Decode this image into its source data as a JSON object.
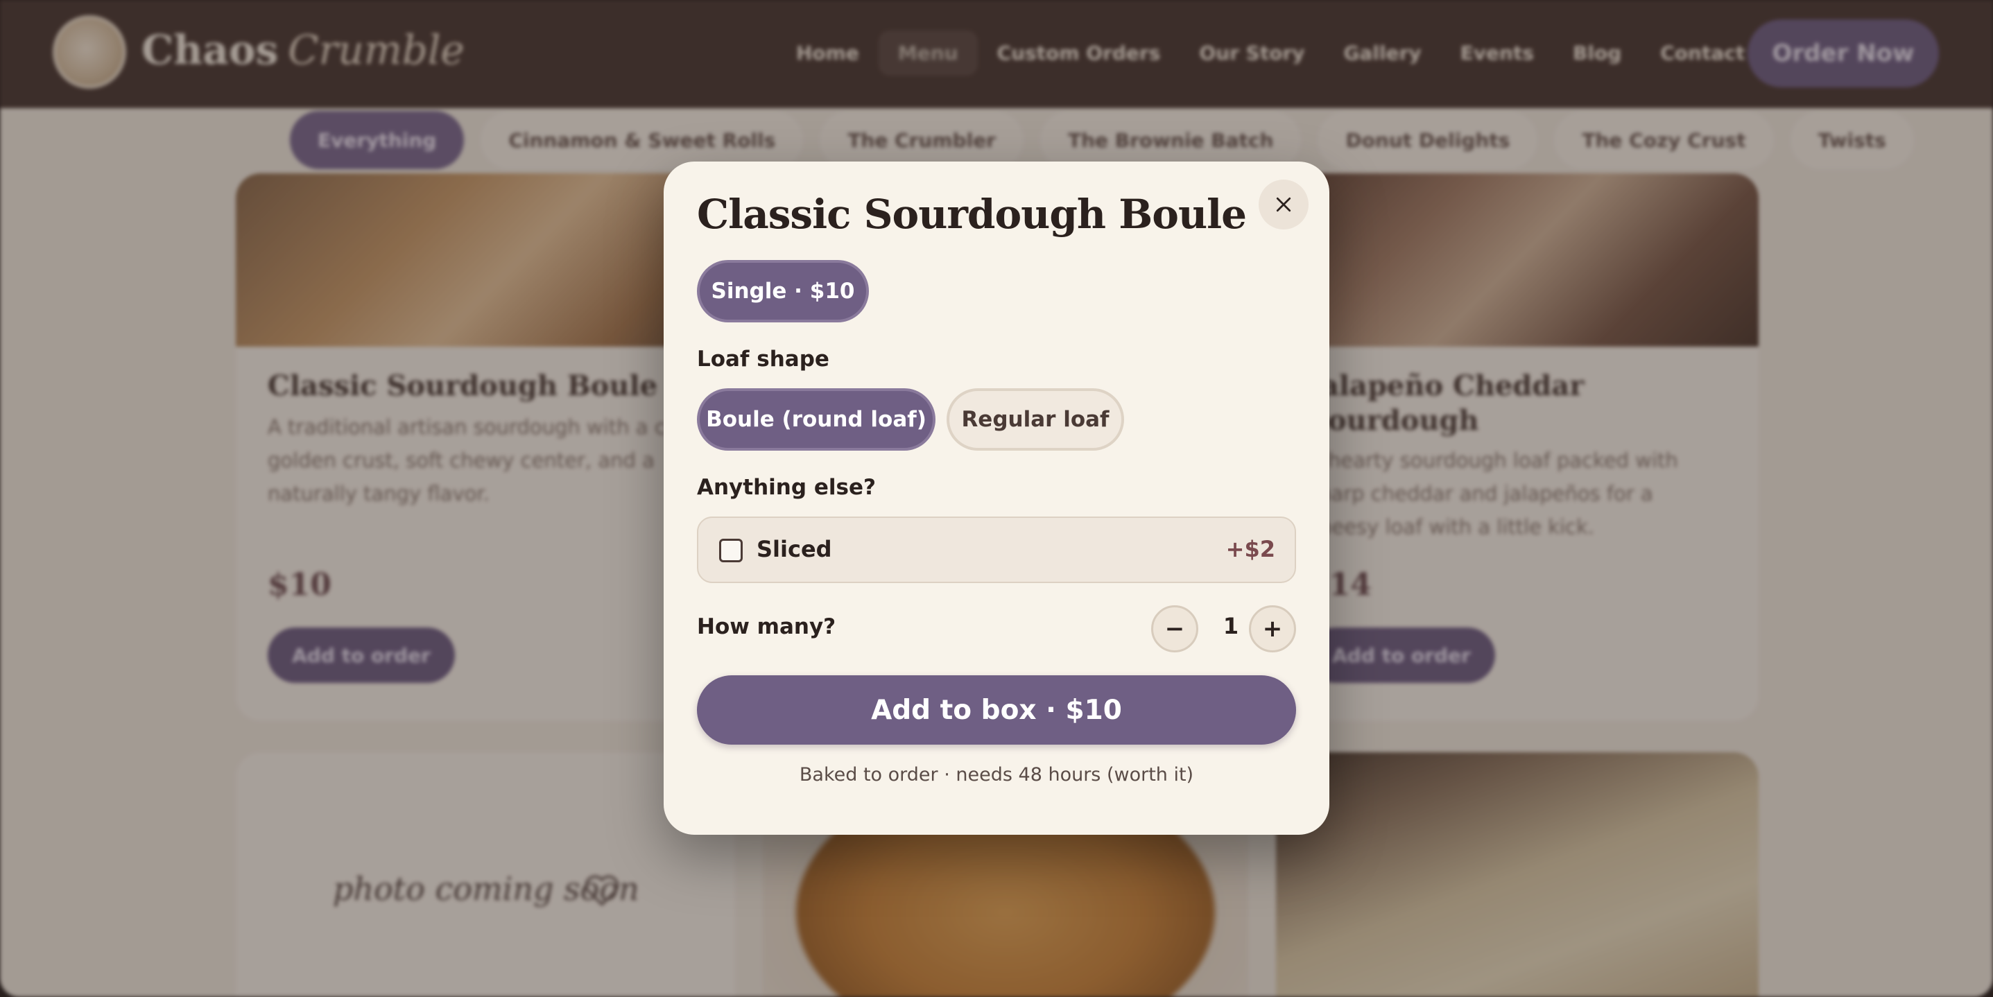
{
  "brand": {
    "name": "Chaos",
    "name_accent": "Crumble"
  },
  "nav": {
    "items": [
      {
        "label": "Home",
        "active": false
      },
      {
        "label": "Menu",
        "active": true
      },
      {
        "label": "Custom Orders",
        "active": false
      },
      {
        "label": "Our Story",
        "active": false
      },
      {
        "label": "Gallery",
        "active": false
      },
      {
        "label": "Events",
        "active": false
      },
      {
        "label": "Blog",
        "active": false
      },
      {
        "label": "Contact",
        "active": false
      }
    ],
    "cta": "Order Now"
  },
  "categories": [
    "Everything",
    "Cinnamon & Sweet Rolls",
    "The Crumbler",
    "The Brownie Batch",
    "Donut Delights",
    "The Cozy Crust",
    "Twists"
  ],
  "background_cards": [
    {
      "title": "Classic Sourdough Boule",
      "description": "A traditional artisan sourdough with a crisp golden crust, soft chewy center, and a naturally tangy flavor.",
      "price": "$10",
      "button": "Add to order"
    },
    {
      "title": "Jalapeño Cheddar Sourdough",
      "description": "A hearty sourdough loaf packed with sharp cheddar and jalapeños for a cheesy loaf with a little kick.",
      "price": "$14",
      "button": "Add to order"
    }
  ],
  "placeholder_caption": "photo coming soon",
  "modal": {
    "title": "Classic Sourdough Boule",
    "size_option": "Single · $10",
    "loaf_shape": {
      "label": "Loaf shape",
      "options": [
        {
          "label": "Boule (round loaf)",
          "selected": true
        },
        {
          "label": "Regular loaf",
          "selected": false
        }
      ]
    },
    "extras": {
      "label": "Anything else?",
      "options": [
        {
          "label": "Sliced",
          "price": "+$2",
          "checked": false
        }
      ]
    },
    "quantity": {
      "label": "How many?",
      "value": "1",
      "minus": "−",
      "plus": "+"
    },
    "add_button": "Add to box · $10",
    "footnote": "Baked to order · needs 48 hours (worth it)"
  },
  "colors": {
    "accent_purple": "#6f5f84",
    "modal_bg": "#f8f3ea",
    "topbar": "#4a3934",
    "extra_price": "#7a4a4e"
  }
}
